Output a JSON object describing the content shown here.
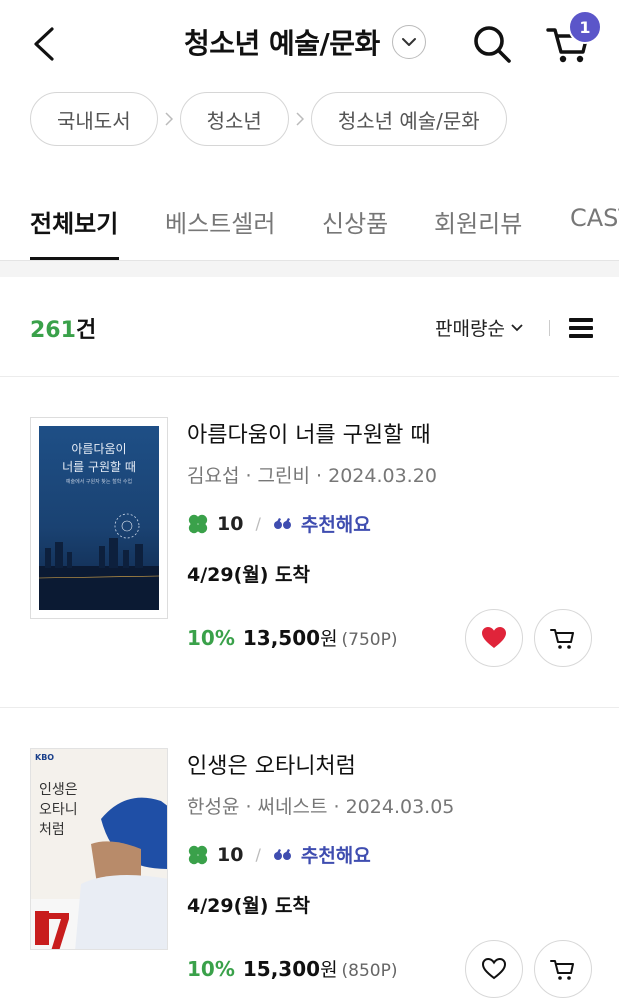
{
  "header": {
    "title": "청소년 예술/문화",
    "cart_count": "1"
  },
  "breadcrumb": [
    "국내도서",
    "청소년",
    "청소년 예술/문화"
  ],
  "tabs": [
    "전체보기",
    "베스트셀러",
    "신상품",
    "회원리뷰",
    "CAST"
  ],
  "list": {
    "count_number": "261",
    "count_suffix": "건",
    "sort_label": "판매량순"
  },
  "books": [
    {
      "cover_title_line1": "아름다움이",
      "cover_title_line2": "너를 구원할 때",
      "cover_subtitle": "예술에서 구원자 찾는 철학 수업",
      "title": "아름다움이 너를 구원할 때",
      "meta": "김요섭 · 그린비 · 2024.03.20",
      "clover_count": "10",
      "recommend": "추천해요",
      "arrival": "4/29(월) 도착",
      "discount": "10%",
      "price": "13,500",
      "price_unit": "원",
      "points": "(750P)",
      "liked": true
    },
    {
      "cover_badge": "KBO",
      "cover_title_line1": "인생은",
      "cover_title_line2": "오타니",
      "cover_title_line3": "처럼",
      "cover_number": "17",
      "title": "인생은 오타니처럼",
      "meta": "한성윤 · 써네스트 · 2024.03.05",
      "clover_count": "10",
      "recommend": "추천해요",
      "arrival": "4/29(월) 도착",
      "discount": "10%",
      "price": "15,300",
      "price_unit": "원",
      "points": "(850P)",
      "liked": false
    }
  ],
  "colors": {
    "accent_green": "#3aa14a",
    "badge_purple": "#5b56c9",
    "recommend_blue": "#3f4db0",
    "heart_red": "#e0243a"
  }
}
